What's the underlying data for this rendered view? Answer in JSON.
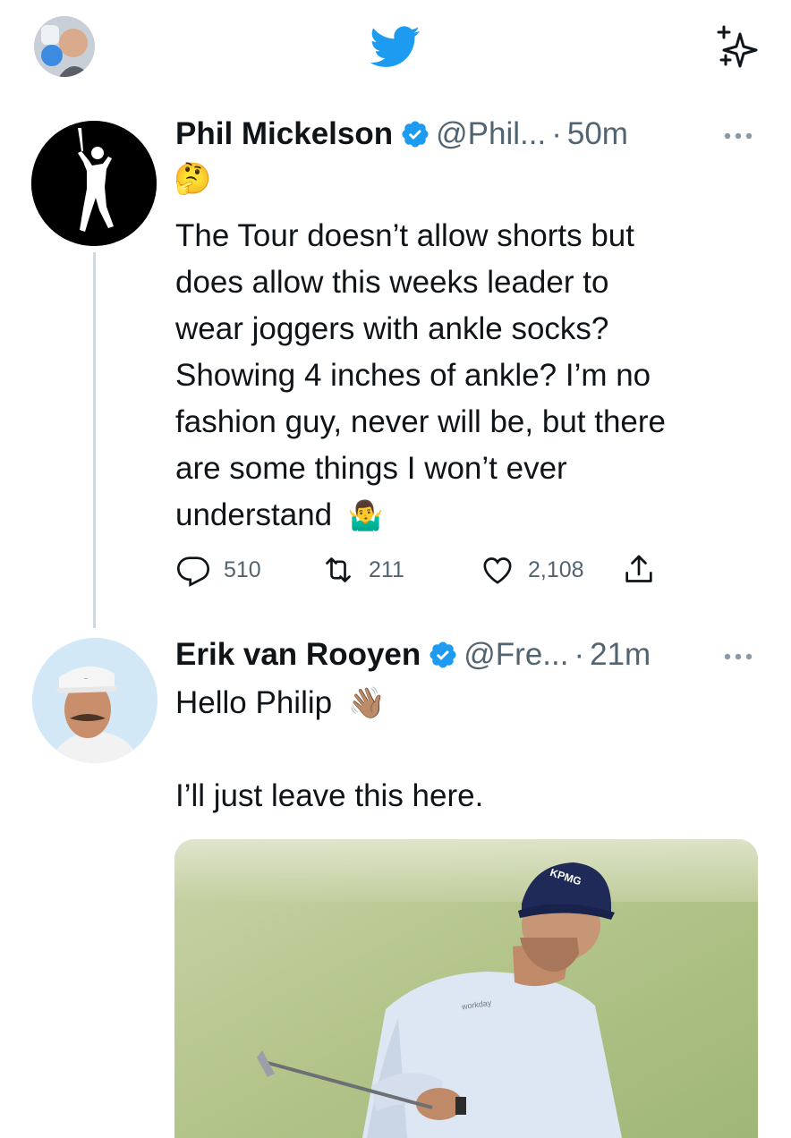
{
  "header": {
    "logo_icon": "twitter-bird-icon",
    "feature_icon": "sparkle-icon",
    "accent": "#1d9bf0"
  },
  "tweets": [
    {
      "name": "Phil Mickelson",
      "handle": "@Phil...",
      "dot": "·",
      "time": "50m",
      "verified": true,
      "lead_emoji": "🤔",
      "lines": [
        "The Tour doesn’t allow shorts but",
        "does allow this weeks leader to",
        "wear joggers with ankle socks?",
        "Showing 4 inches of ankle? I’m no",
        "fashion guy, never will be, but there",
        "are some things I  won’t ever",
        "understand"
      ],
      "trail_emoji": "🤷‍♂️",
      "stats": {
        "replies": "510",
        "retweets": "211",
        "likes": "2,108"
      }
    },
    {
      "name": "Erik van Rooyen",
      "handle": "@Fre...",
      "dot": "·",
      "time": "21m",
      "verified": true,
      "line1": "Hello Philip",
      "line1_emoji": "👋🏽",
      "line2": "I’ll just leave this here.",
      "media": {
        "cap_text": "KPMG",
        "shirt_text": "workday"
      }
    }
  ],
  "colors": {
    "text": "#0f1419",
    "secondary": "#536471",
    "verified": "#1d9bf0",
    "divider": "#cfd9de"
  }
}
